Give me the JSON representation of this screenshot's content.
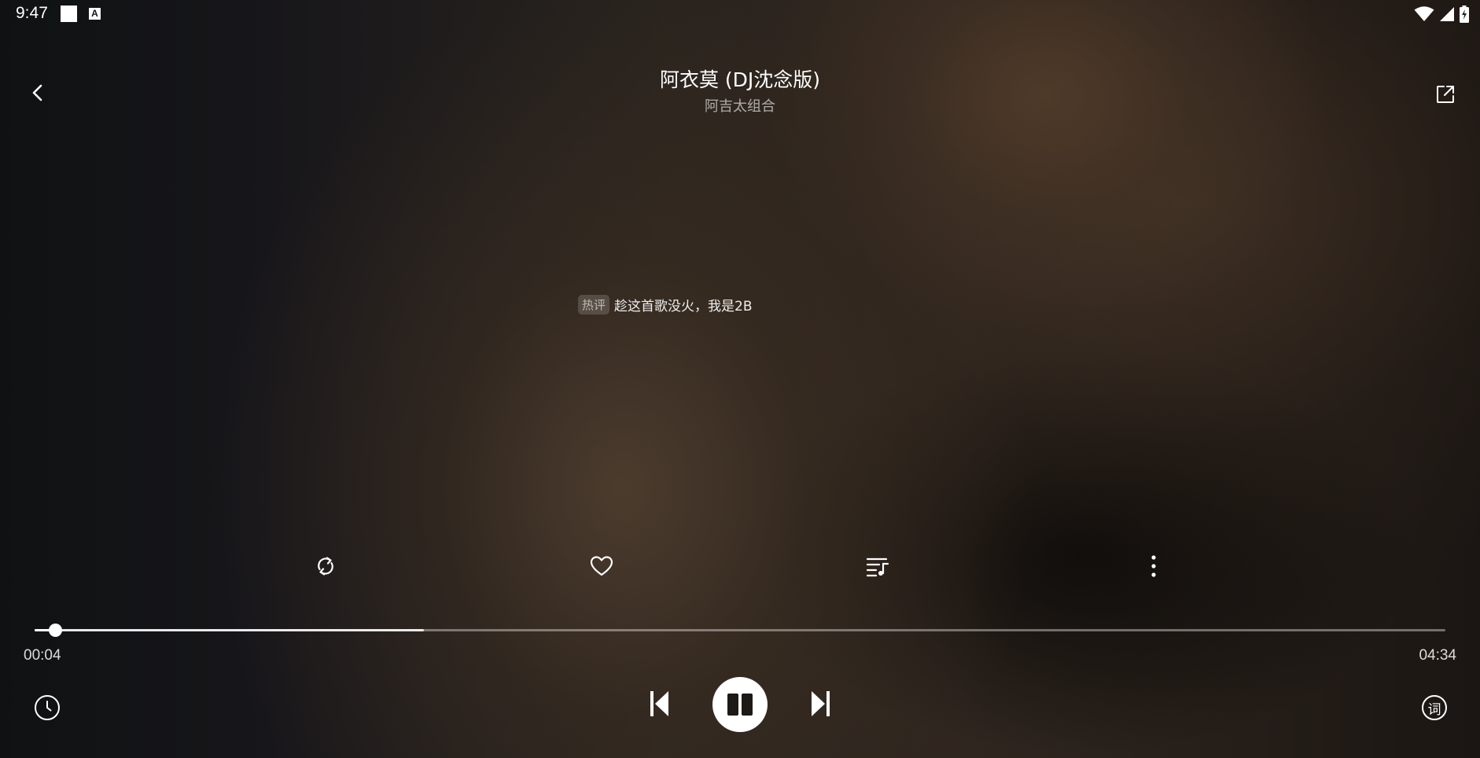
{
  "status_bar": {
    "time": "9:47",
    "notification_icons": [
      "white-square-icon",
      "a-badge-icon"
    ],
    "a_badge_letter": "A",
    "system_icons": [
      "wifi-icon",
      "cell-signal-icon",
      "battery-charging-icon"
    ]
  },
  "header": {
    "title": "阿衣莫 (DJ沈念版)",
    "artist": "阿吉太组合",
    "back_icon": "chevron-left-icon",
    "share_icon": "share-external-icon"
  },
  "hot_comment": {
    "tag": "热评",
    "text": "趁这首歌没火，我是2B"
  },
  "actions": [
    {
      "name": "repeat",
      "icon": "repeat-icon"
    },
    {
      "name": "favorite",
      "icon": "heart-icon"
    },
    {
      "name": "playlist",
      "icon": "playlist-icon"
    },
    {
      "name": "more",
      "icon": "more-vertical-icon"
    }
  ],
  "progress": {
    "current_time": "00:04",
    "total_time": "04:34",
    "played_fraction": 0.0146,
    "buffered_fraction": 0.276
  },
  "controls": {
    "prev_icon": "skip-previous-icon",
    "play_pause_icon": "pause-icon",
    "next_icon": "skip-next-icon",
    "timer_icon": "clock-icon",
    "lyrics_label": "词"
  },
  "colors": {
    "foreground": "#ffffff",
    "secondary_text": "#9e9a96"
  }
}
